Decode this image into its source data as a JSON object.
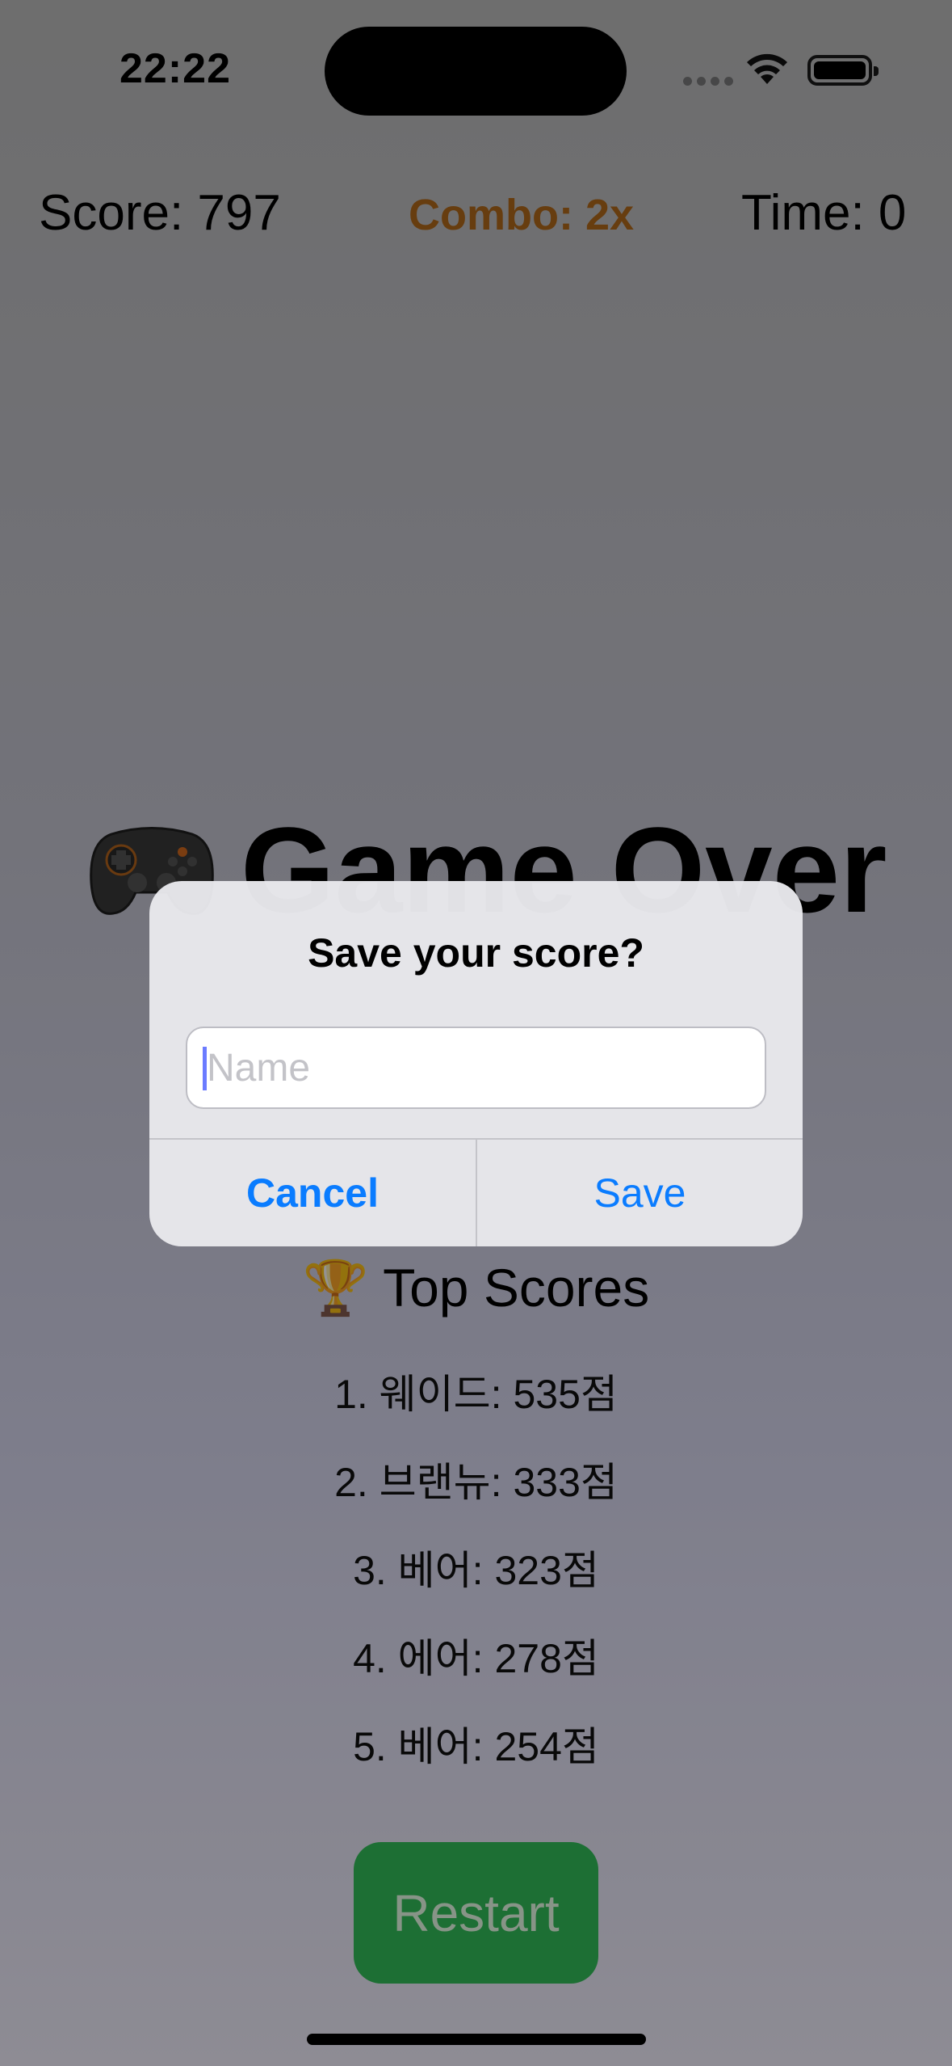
{
  "status_bar": {
    "time": "22:22"
  },
  "hud": {
    "score": "Score: 797",
    "combo": "Combo: 2x",
    "time": "Time: 0"
  },
  "game_over": {
    "title": "Game Over",
    "icon": "game-controller-icon"
  },
  "leaderboard": {
    "title": "Top Scores",
    "icon": "trophy-icon",
    "entries": [
      "1. 웨이드: 535점",
      "2. 브랜뉴: 333점",
      "3. 베어: 323점",
      "4. 에어: 278점",
      "5. 베어: 254점"
    ]
  },
  "restart_label": "Restart",
  "alert": {
    "title": "Save your score?",
    "input_placeholder": "Name",
    "input_value": "",
    "cancel_label": "Cancel",
    "save_label": "Save"
  },
  "colors": {
    "accent": "#0a7cff",
    "combo": "#b26a1a",
    "restart": "#33c05a"
  }
}
